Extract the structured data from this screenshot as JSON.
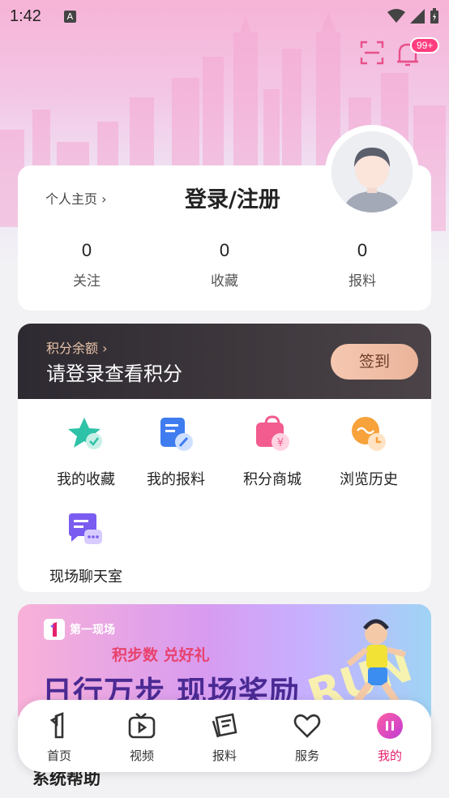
{
  "status_bar": {
    "time": "1:42",
    "notification_letter": "A"
  },
  "header": {
    "notification_badge": "99+"
  },
  "profile": {
    "home_link": "个人主页",
    "login_title": "登录/注册",
    "stats": [
      {
        "value": "0",
        "label": "关注"
      },
      {
        "value": "0",
        "label": "收藏"
      },
      {
        "value": "0",
        "label": "报料"
      }
    ]
  },
  "points": {
    "label": "积分余额",
    "main_text": "请登录查看积分",
    "checkin_label": "签到"
  },
  "grid": [
    {
      "label": "我的收藏",
      "icon": "star-check-icon"
    },
    {
      "label": "我的报料",
      "icon": "document-edit-icon"
    },
    {
      "label": "积分商城",
      "icon": "shopping-bag-icon"
    },
    {
      "label": "浏览历史",
      "icon": "history-clock-icon"
    },
    {
      "label": "现场聊天室",
      "icon": "chat-room-icon"
    }
  ],
  "banner": {
    "logo_text": "第一现场",
    "subtitle": "积步数 兑好礼",
    "headline": "日行万步 现场奖励",
    "art_text": "RUN"
  },
  "section_title": "系统帮助",
  "tabs": [
    {
      "label": "首页",
      "icon": "home-1-icon",
      "active": false
    },
    {
      "label": "视频",
      "icon": "video-tv-icon",
      "active": false
    },
    {
      "label": "报料",
      "icon": "report-note-icon",
      "active": false
    },
    {
      "label": "服务",
      "icon": "heart-icon",
      "active": false
    },
    {
      "label": "我的",
      "icon": "my-profile-icon",
      "active": true
    }
  ],
  "colors": {
    "accent": "#e5226e",
    "points_bg": "#2e2a31",
    "checkin_bg": "#f1bea6"
  }
}
